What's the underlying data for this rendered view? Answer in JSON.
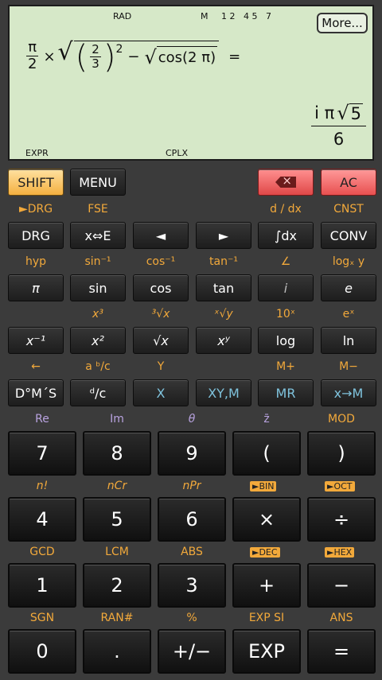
{
  "display": {
    "indicators": {
      "rad": "RAD",
      "m": "M",
      "digits": "1 2   4 5   7",
      "expr": "EXPR",
      "cplx": "CPLX"
    },
    "more_label": "More...",
    "expression": {
      "pi": "π",
      "two": "2",
      "times": "×",
      "two_b": "2",
      "three": "3",
      "square": "2",
      "minus": "−",
      "cos_arg": "cos(2 π)",
      "equals": "="
    },
    "result": {
      "i_pi": "i π",
      "root5": "5",
      "six": "6"
    }
  },
  "top_row": {
    "shift": "SHIFT",
    "menu": "MENU",
    "ac": "AC"
  },
  "rows": [
    {
      "subs": [
        "►DRG",
        "FSE",
        "",
        "",
        "d / dx",
        "CNST"
      ],
      "keys": [
        "DRG",
        "x⇔E",
        "◄",
        "►",
        "∫dx",
        "CONV"
      ]
    },
    {
      "subs": [
        "hyp",
        "sin⁻¹",
        "cos⁻¹",
        "tan⁻¹",
        "∠",
        "logₓ y"
      ],
      "keys": [
        "π",
        "sin",
        "cos",
        "tan",
        "i",
        "e"
      ]
    },
    {
      "subs": [
        "",
        "x³",
        "³√x",
        "ˣ√y",
        "10ˣ",
        "eˣ"
      ],
      "keys": [
        "x⁻¹",
        "x²",
        "√x",
        "xʸ",
        "log",
        "ln"
      ]
    },
    {
      "subs": [
        "←",
        "a ᵇ/c",
        "Y",
        "",
        "M+",
        "M−"
      ],
      "keys": [
        "D°M´S",
        "ᵈ/c",
        "X",
        "XY,M",
        "MR",
        "x→M"
      ]
    }
  ],
  "big_rows": [
    {
      "subs": [
        "Re",
        "Im",
        "θ",
        "z̄",
        "MOD"
      ],
      "keys": [
        "7",
        "8",
        "9",
        "(",
        ")"
      ]
    },
    {
      "subs": [
        "n!",
        "nCr",
        "nPr",
        "►BIN",
        "►OCT"
      ],
      "keys": [
        "4",
        "5",
        "6",
        "×",
        "÷"
      ]
    },
    {
      "subs": [
        "GCD",
        "LCM",
        "ABS",
        "►DEC",
        "►HEX"
      ],
      "keys": [
        "1",
        "2",
        "3",
        "+",
        "−"
      ]
    },
    {
      "subs": [
        "SGN",
        "RAN#",
        "%",
        "EXP SI",
        "ANS"
      ],
      "keys": [
        "0",
        ".",
        "+/−",
        "EXP",
        "="
      ]
    }
  ],
  "colors": {
    "orange": "#f2a93b",
    "purple": "#b9a3e0",
    "lcd": "#d6e8c8"
  }
}
